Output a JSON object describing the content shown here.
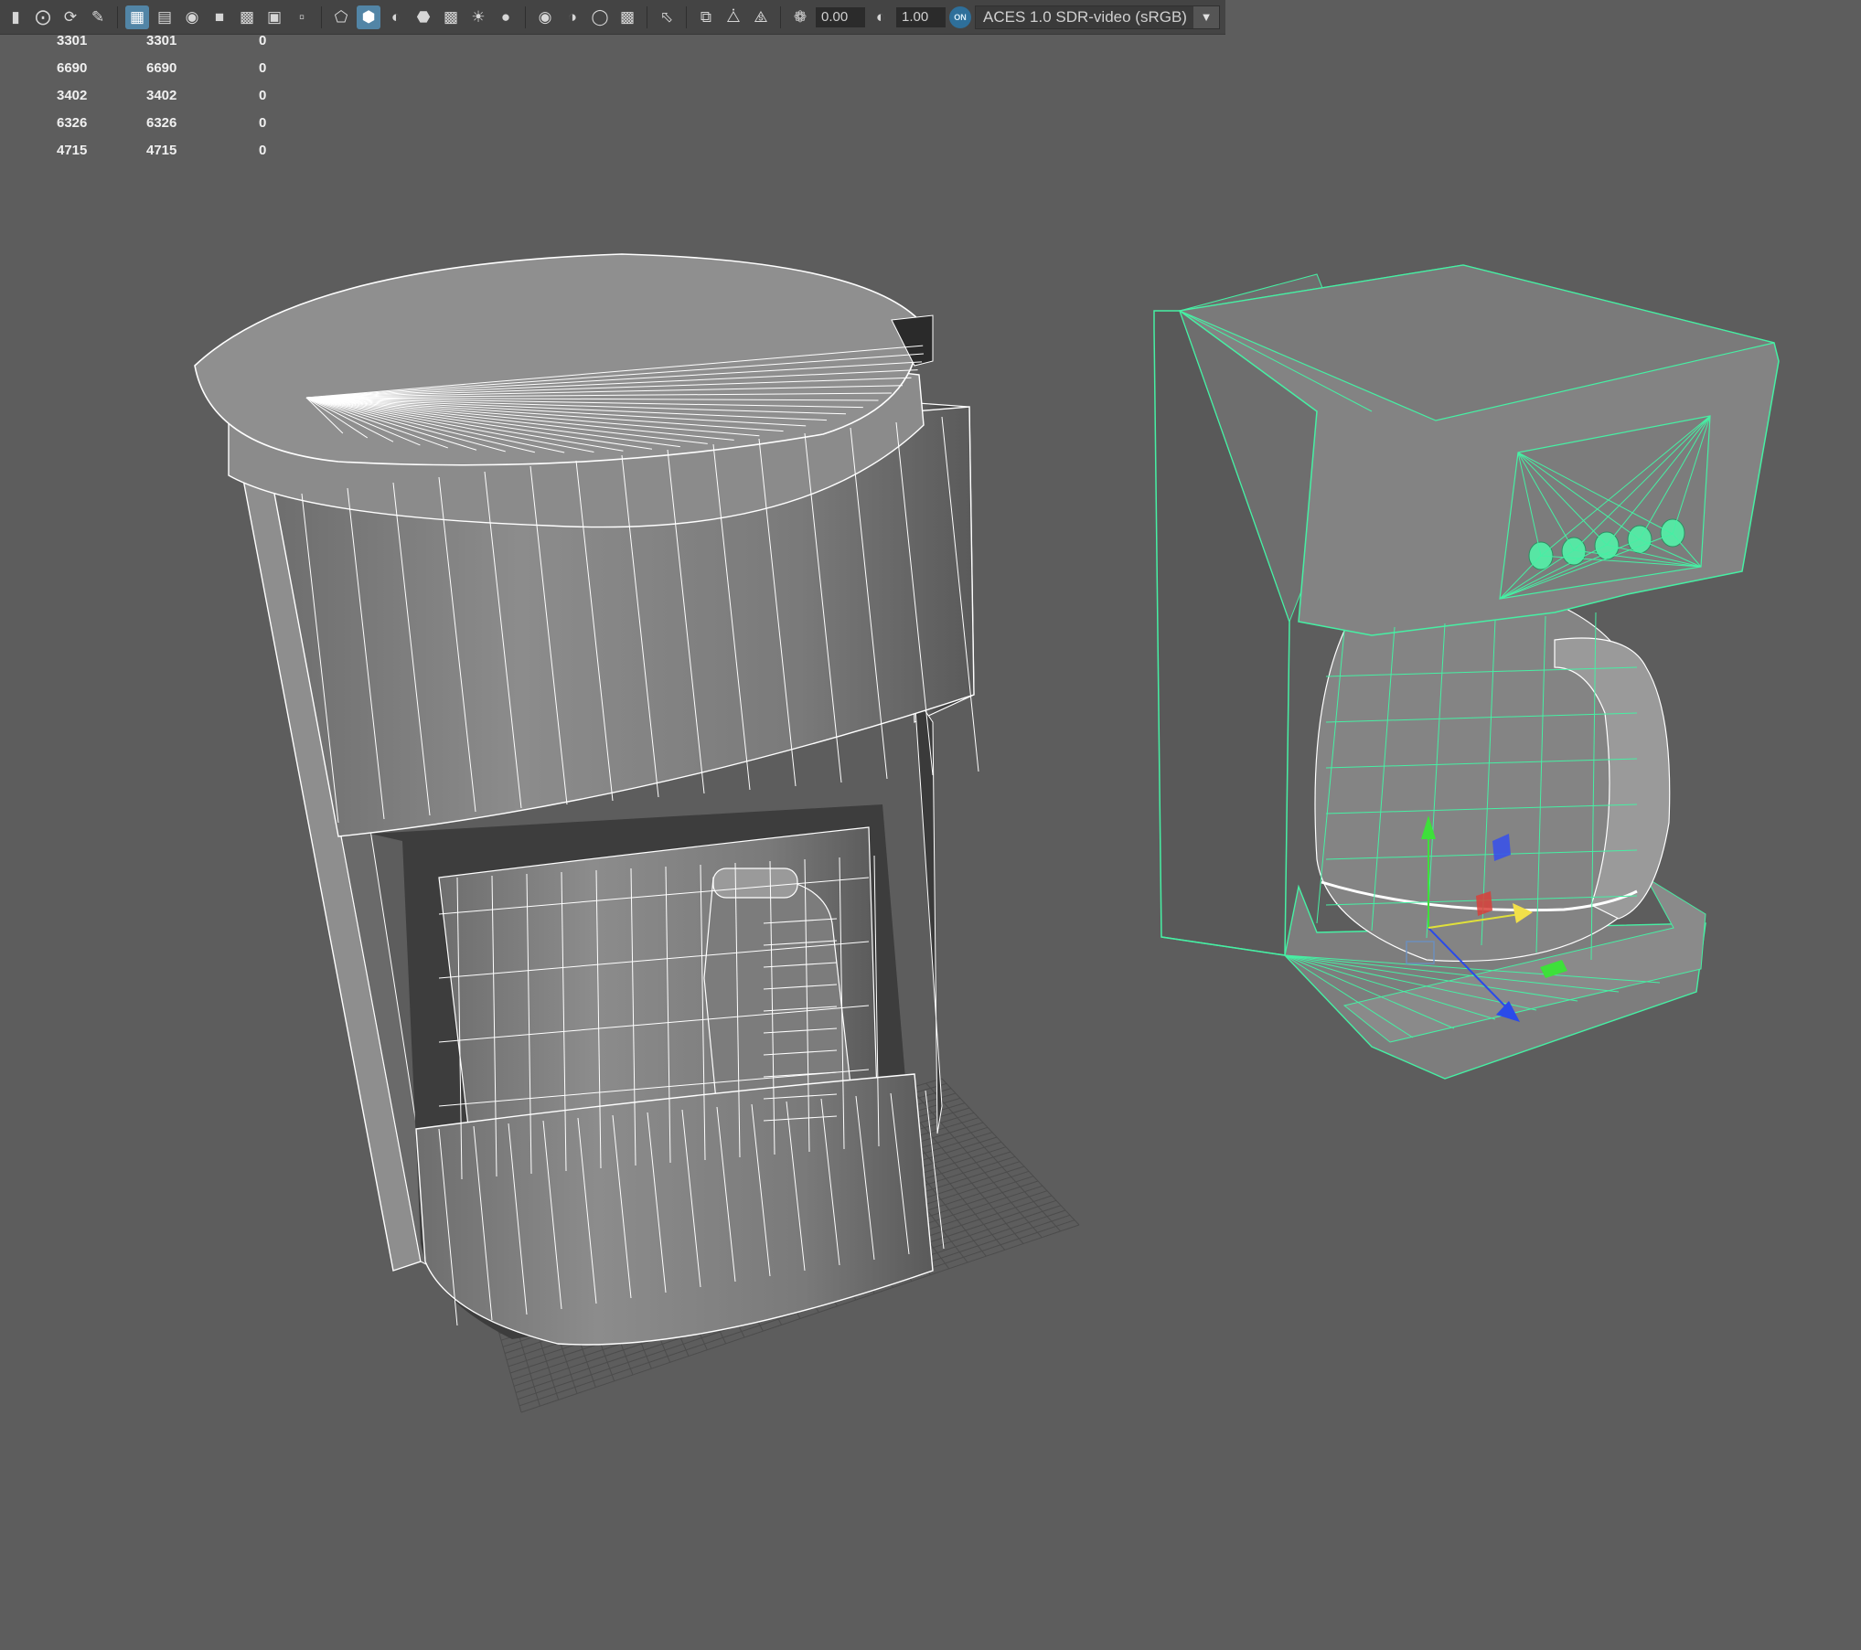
{
  "toolbar": {
    "icons": [
      "bookmark-icon",
      "camera-attributes-icon",
      "camera-tumble-icon",
      "brush-icon",
      "grid-icon",
      "film-gate-icon",
      "resolution-gate-icon",
      "gate-mask-icon",
      "field-chart-icon",
      "safe-action-icon",
      "safe-title-icon",
      "wireframe-icon",
      "smooth-shade-icon",
      "shade-half-icon",
      "wireframe-on-shaded-icon",
      "texture-checker-icon",
      "lights-icon",
      "shadows-icon",
      "ambient-occlusion-icon",
      "motion-blur-icon",
      "anti-aliasing-icon",
      "depth-of-field-icon",
      "isolate-select-icon",
      "xray-icon",
      "xray-joints-icon",
      "xray-components-icon",
      "exposure-icon",
      "gamma-icon",
      "color-management-icon"
    ],
    "active_icons": [
      "grid-icon",
      "smooth-shade-icon"
    ],
    "exposure_value": "0.00",
    "gamma_value": "1.00",
    "color_management_badge": "ON",
    "view_transform": "ACES 1.0 SDR-video (sRGB)"
  },
  "hud_stats": [
    {
      "a": "3301",
      "b": "3301",
      "c": "0"
    },
    {
      "a": "6690",
      "b": "6690",
      "c": "0"
    },
    {
      "a": "3402",
      "b": "3402",
      "c": "0"
    },
    {
      "a": "6326",
      "b": "6326",
      "c": "0"
    },
    {
      "a": "4715",
      "b": "4715",
      "c": "0"
    }
  ],
  "colors": {
    "viewport_bg": "#5d5d5d",
    "mesh_fill": "#8a8a8a",
    "wire": "#ffffff",
    "selection_wire": "#46f0a4",
    "axis_x": "#e03a3a",
    "axis_y": "#3ee03a",
    "axis_z": "#2a4bea",
    "active_button": "#5285a6"
  },
  "viewport": {
    "objects": [
      "coffee-maker-model-left",
      "coffee-maker-model-right-selected"
    ],
    "manipulator": "move-tool"
  }
}
